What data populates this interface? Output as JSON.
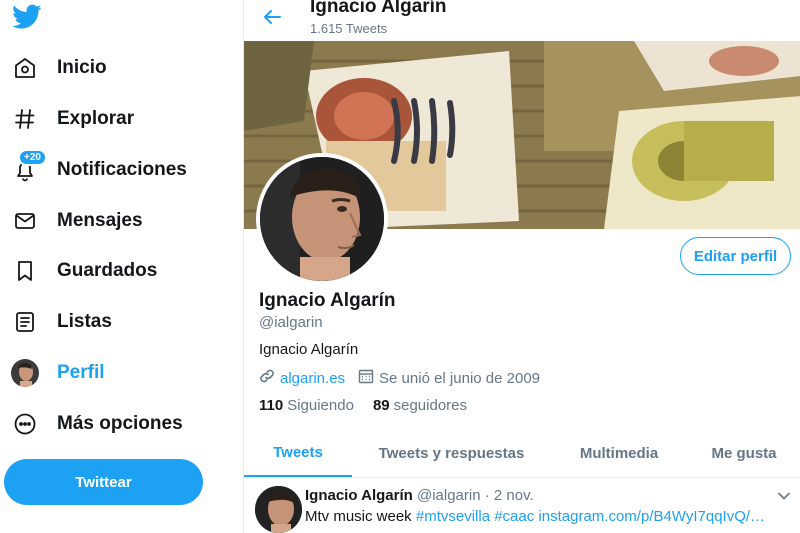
{
  "sidebar": {
    "logo": "twitter-bird-icon",
    "items": [
      {
        "label": "Inicio",
        "icon": "home-icon"
      },
      {
        "label": "Explorar",
        "icon": "hashtag-icon"
      },
      {
        "label": "Notificaciones",
        "icon": "bell-icon",
        "badge": "+20"
      },
      {
        "label": "Mensajes",
        "icon": "envelope-icon"
      },
      {
        "label": "Guardados",
        "icon": "bookmark-icon"
      },
      {
        "label": "Listas",
        "icon": "list-icon"
      },
      {
        "label": "Perfil",
        "icon": "avatar",
        "active": true
      },
      {
        "label": "Más opciones",
        "icon": "more-icon"
      }
    ],
    "tweet_button": "Twittear"
  },
  "header": {
    "name": "Ignacio Algarín",
    "tweet_count": "1.615 Tweets"
  },
  "profile": {
    "name": "Ignacio Algarín",
    "handle": "@ialgarin",
    "bio": "Ignacio Algarín",
    "website": "algarin.es",
    "joined": "Se unió el junio de 2009",
    "following_count": "110",
    "following_label": "Siguiendo",
    "followers_count": "89",
    "followers_label": "seguidores",
    "edit_button": "Editar perfil"
  },
  "tabs": [
    {
      "label": "Tweets",
      "active": true
    },
    {
      "label": "Tweets y respuestas"
    },
    {
      "label": "Multimedia"
    },
    {
      "label": "Me gusta"
    }
  ],
  "tweet": {
    "author": "Ignacio Algarín",
    "handle": "@ialgarin",
    "separator": "·",
    "date": "2 nov.",
    "text_plain": "Mtv music week ",
    "hashtag1": "#mtvsevilla",
    "hashtag2": "#caac",
    "link": "instagram.com/p/B4WyI7qqIvQ/…"
  },
  "colors": {
    "accent": "#1da1f2",
    "text": "#14171a",
    "secondary": "#657786",
    "border": "#e6ecf0"
  }
}
